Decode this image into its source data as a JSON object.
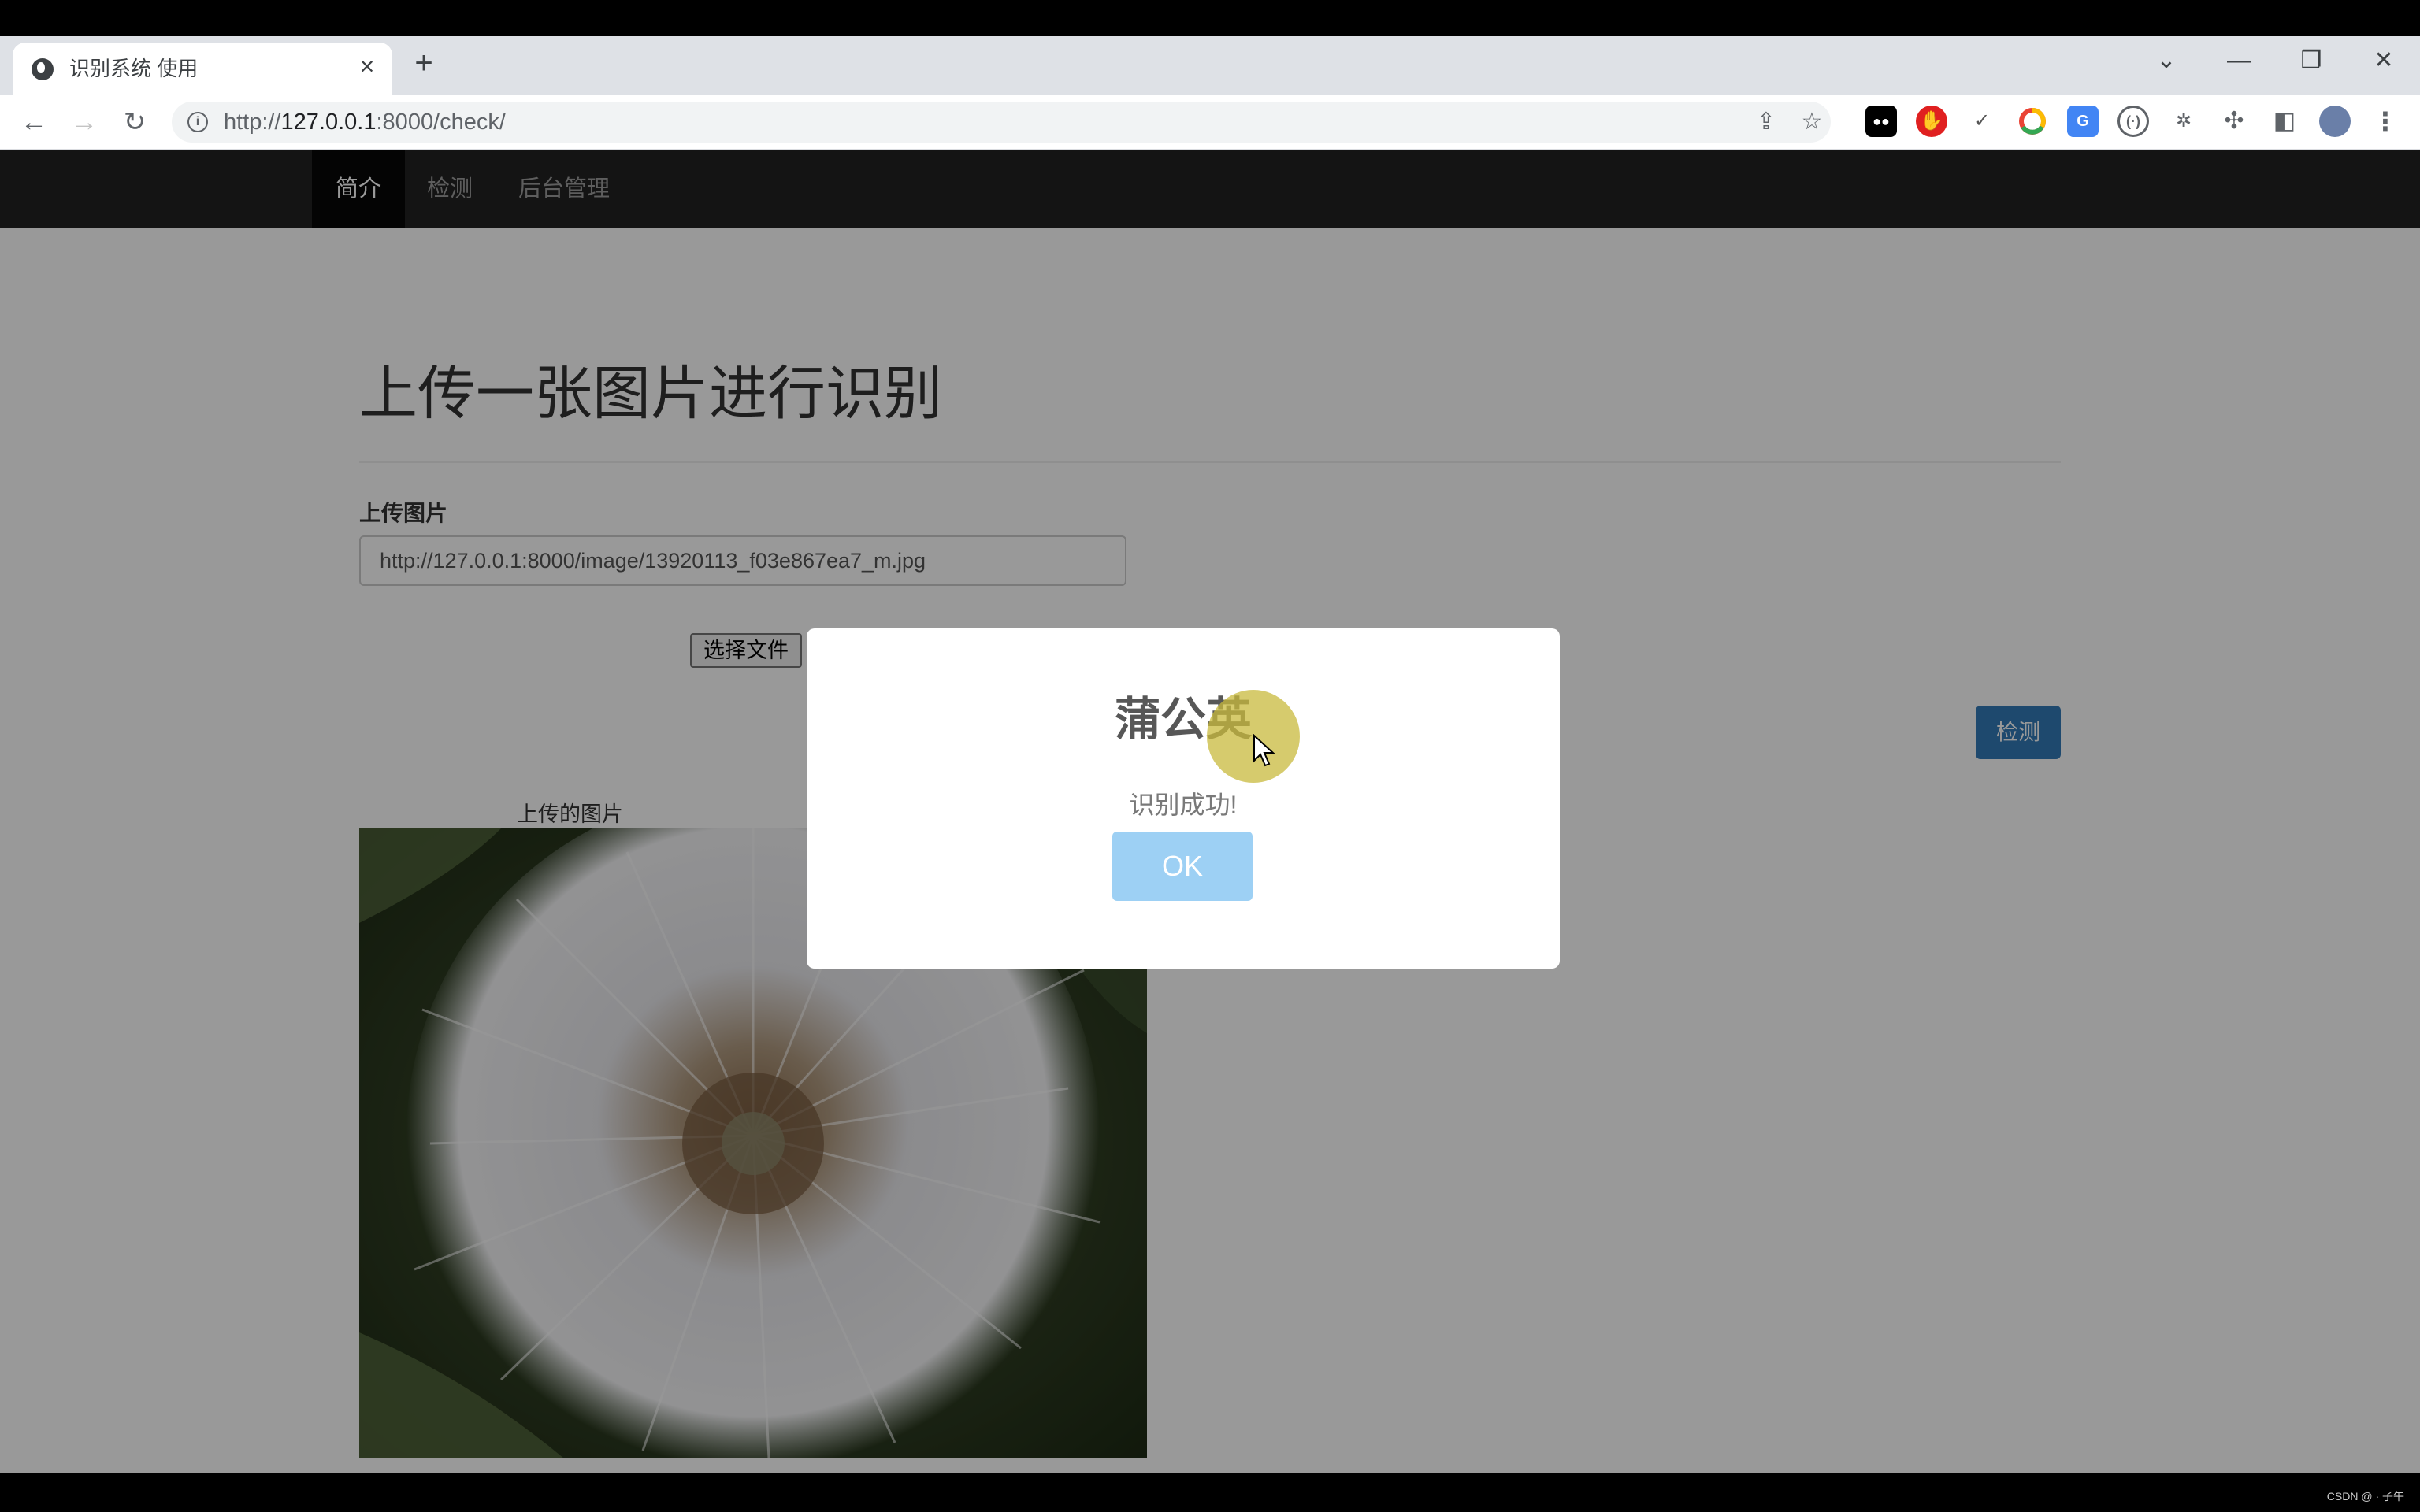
{
  "browser": {
    "tab_title": "识别系统 使用",
    "url_prefix": "http://",
    "url_host": "127.0.0.1",
    "url_rest": ":8000/check/",
    "tab_close": "×",
    "new_tab": "+"
  },
  "navbar": {
    "items": [
      {
        "label": "简介",
        "active": true
      },
      {
        "label": "检测",
        "active": false
      },
      {
        "label": "后台管理",
        "active": false
      }
    ]
  },
  "main": {
    "heading": "上传一张图片进行识别",
    "upload_label": "上传图片",
    "upload_value": "http://127.0.0.1:8000/image/13920113_f03e867ea7_m.jpg",
    "file_button": "选择文件",
    "check_button": "检测",
    "image_caption": "上传的图片"
  },
  "modal": {
    "title": "蒲公英",
    "text": "识别成功!",
    "ok_label": "OK",
    "ok_color": "#9dd0f4"
  },
  "footer": {
    "watermark": "CSDN @ · 子午"
  },
  "colors": {
    "navbar": "#222222",
    "primary_button": "#337ab7"
  }
}
